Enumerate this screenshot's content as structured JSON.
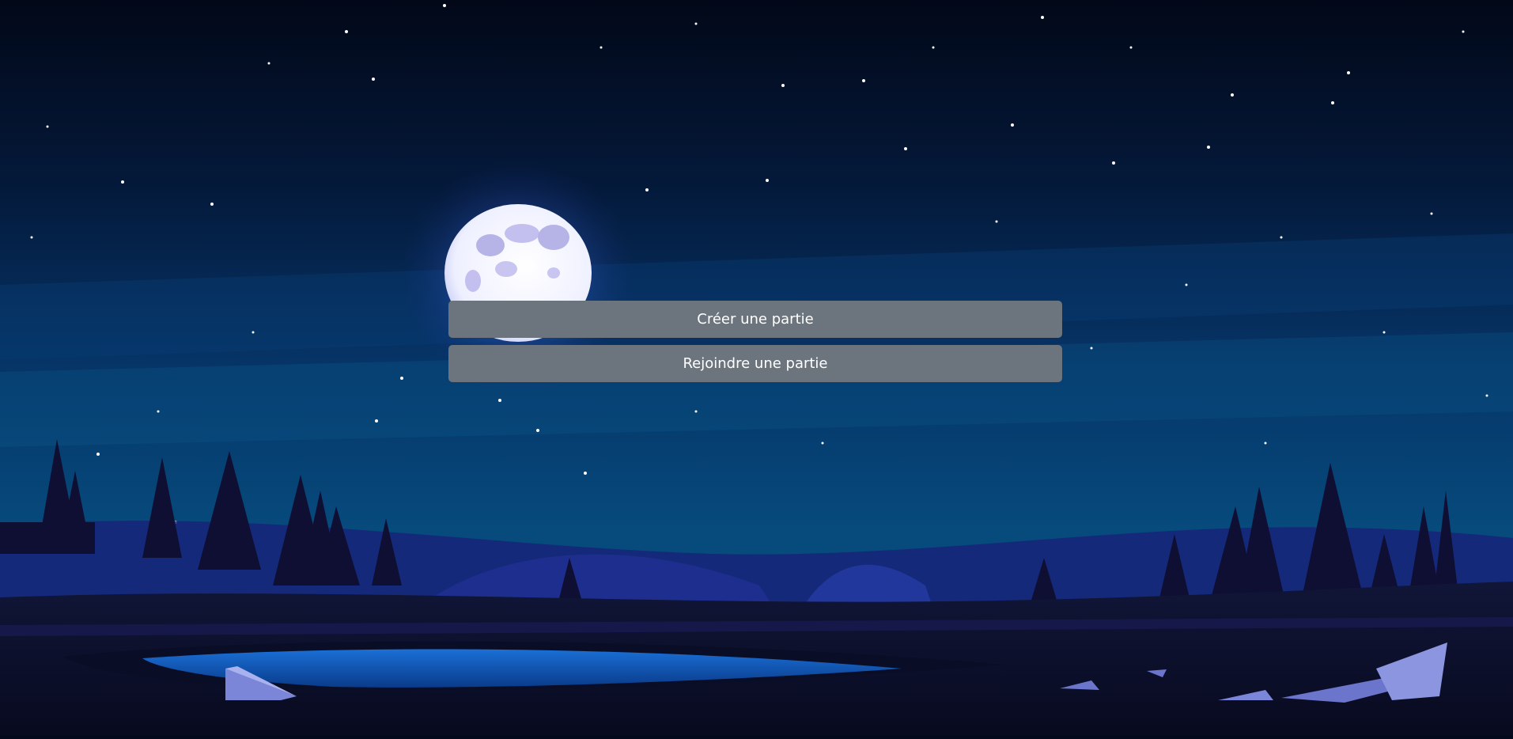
{
  "menu": {
    "create_game_label": "Créer une partie",
    "join_game_label": "Rejoindre une partie"
  },
  "theme": {
    "button_color": "#6c757d",
    "button_text_color": "#ffffff",
    "sky_top_color": "#020a1c",
    "sky_bottom_color": "#0a4a7a"
  },
  "background": {
    "scene": "night-landscape",
    "elements": [
      "starry-sky",
      "full-moon",
      "pine-trees",
      "hills",
      "pond",
      "rocks"
    ]
  }
}
